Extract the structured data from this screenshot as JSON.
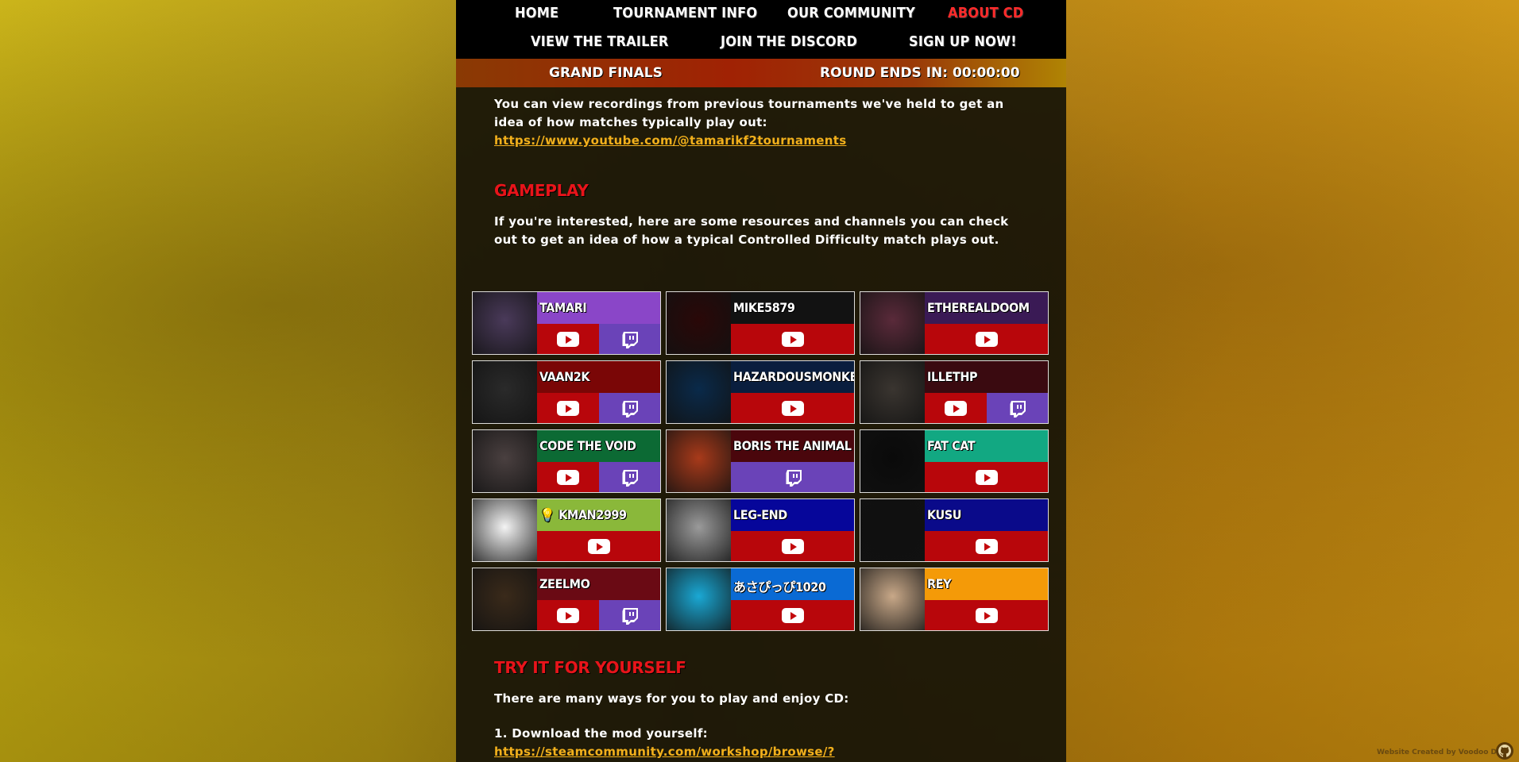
{
  "nav": {
    "row1": [
      "HOME",
      "TOURNAMENT INFO",
      "OUR COMMUNITY",
      "ABOUT CD"
    ],
    "row2": [
      "VIEW THE TRAILER",
      "JOIN THE DISCORD",
      "SIGN UP NOW!"
    ],
    "active": "ABOUT CD"
  },
  "status_bar": {
    "left": "GRAND FINALS",
    "right": "ROUND ENDS IN: 00:00:00"
  },
  "intro": {
    "text": "You can view recordings from previous tournaments we've held to get an idea of how matches typically play out:",
    "link": "https://www.youtube.com/@tamarikf2tournaments"
  },
  "gameplay": {
    "heading": "GAMEPLAY",
    "text": "If you're interested, here are some resources and channels you can check out to get an idea of how a typical Controlled Difficulty match plays out."
  },
  "creators": [
    {
      "name": "TAMARI",
      "strip_color": "#8a46c8",
      "avatar_color": "#4a3a5a",
      "buttons": [
        "youtube",
        "twitch"
      ]
    },
    {
      "name": "MIKE5879",
      "strip_color": "#121212",
      "avatar_color": "#2a0808",
      "buttons": [
        "youtube"
      ]
    },
    {
      "name": "ETHEREALDOOM",
      "strip_color": "#3a1a55",
      "avatar_color": "#5a2a3a",
      "buttons": [
        "youtube"
      ]
    },
    {
      "name": "VAAN2K",
      "strip_color": "#7a0606",
      "avatar_color": "#2a2a2a",
      "buttons": [
        "youtube",
        "twitch"
      ]
    },
    {
      "name": "HAZARDOUSMONKEY",
      "strip_color": "#0a1e3e",
      "avatar_color": "#0a2a4a",
      "buttons": [
        "youtube"
      ]
    },
    {
      "name": "ILLETHP",
      "strip_color": "#3a0a10",
      "avatar_color": "#3a3530",
      "buttons": [
        "youtube",
        "twitch"
      ]
    },
    {
      "name": "CODE THE VOID",
      "strip_color": "#0c6a34",
      "avatar_color": "#4a4040",
      "buttons": [
        "youtube",
        "twitch"
      ]
    },
    {
      "name": "BORIS THE ANIMAL",
      "strip_color": "#4a060c",
      "avatar_color": "#a83a1a",
      "buttons": [
        "twitch"
      ]
    },
    {
      "name": "FAT CAT",
      "strip_color": "#12a882",
      "avatar_color": "#0a0a0a",
      "buttons": [
        "youtube"
      ]
    },
    {
      "name": "💡 KMAN2999",
      "strip_color": "#8ab83a",
      "avatar_color": "#f4f4f4",
      "buttons": [
        "youtube"
      ]
    },
    {
      "name": "LEG-END",
      "strip_color": "#06069a",
      "avatar_color": "#9a9a9a",
      "buttons": [
        "youtube"
      ]
    },
    {
      "name": "KUSU",
      "strip_color": "#0a0a8a",
      "avatar_color": "#101010",
      "buttons": [
        "youtube"
      ]
    },
    {
      "name": "ZEELMO",
      "strip_color": "#6a0a14",
      "avatar_color": "#3a2a1a",
      "buttons": [
        "youtube",
        "twitch"
      ]
    },
    {
      "name": "あさぴっぴ1020",
      "strip_color": "#0a6ad4",
      "avatar_color": "#1aa8d4",
      "buttons": [
        "youtube"
      ]
    },
    {
      "name": "REY",
      "strip_color": "#f49a08",
      "avatar_color": "#c8a888",
      "buttons": [
        "youtube"
      ]
    }
  ],
  "try_it": {
    "heading": "TRY IT FOR YOURSELF",
    "text": "There are many ways for you to play and enjoy CD:",
    "step1": "1. Download the mod yourself:",
    "step1_link": "https://steamcommunity.com/workshop/browse/?"
  },
  "footer": {
    "credit": "Website Created by Voodoo Doll"
  },
  "colors": {
    "accent_red": "#e8141a",
    "link_orange": "#f2b01c",
    "youtube_red": "#b8060b",
    "twitch_purple": "#6a43b8"
  }
}
